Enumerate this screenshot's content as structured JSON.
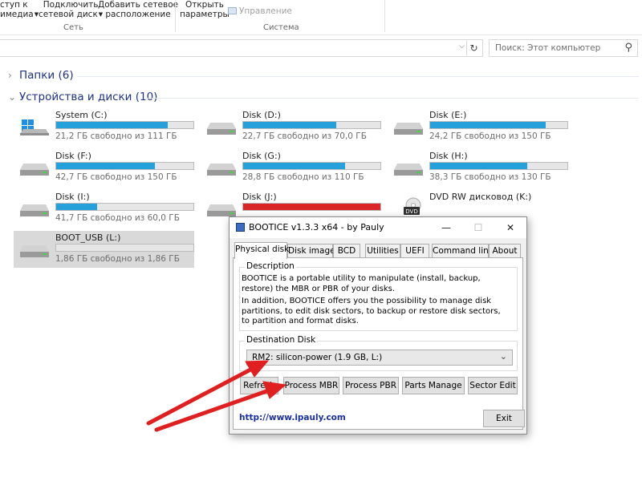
{
  "ribbon": {
    "media_access": {
      "line1": "ступ к",
      "line2": "имедиа"
    },
    "map_drive": {
      "line1": "Подключить",
      "line2": "сетевой диск"
    },
    "add_location": {
      "line1": "Добавить сетевое",
      "line2": "расположение"
    },
    "network_group": "Сеть",
    "open_settings": {
      "line1": "Открыть",
      "line2": "параметры"
    },
    "manage": "Управление",
    "system_group": "Система"
  },
  "address": {
    "refresh_icon": "refresh-icon",
    "search_placeholder": "Поиск: Этот компьютер"
  },
  "sections": {
    "folders": "Папки (6)",
    "devices": "Устройства и диски (10)"
  },
  "drives": [
    {
      "name": "System (C:)",
      "free": "21,2 ГБ свободно из 111 ГБ",
      "used_fraction": 0.81,
      "color": "#26a0da",
      "icon": "windows-drive-icon"
    },
    {
      "name": "Disk (D:)",
      "free": "22,7 ГБ свободно из 70,0 ГБ",
      "used_fraction": 0.68,
      "color": "#26a0da",
      "icon": "hard-drive-icon"
    },
    {
      "name": "Disk (E:)",
      "free": "24,2 ГБ свободно из 150 ГБ",
      "used_fraction": 0.84,
      "color": "#26a0da",
      "icon": "hard-drive-icon"
    },
    {
      "name": "Disk (F:)",
      "free": "42,7 ГБ свободно из 150 ГБ",
      "used_fraction": 0.72,
      "color": "#26a0da",
      "icon": "hard-drive-icon"
    },
    {
      "name": "Disk (G:)",
      "free": "28,8 ГБ свободно из 110 ГБ",
      "used_fraction": 0.74,
      "color": "#26a0da",
      "icon": "hard-drive-icon"
    },
    {
      "name": "Disk (H:)",
      "free": "38,3 ГБ свободно из 130 ГБ",
      "used_fraction": 0.71,
      "color": "#26a0da",
      "icon": "hard-drive-icon"
    },
    {
      "name": "Disk (I:)",
      "free": "41,7 ГБ свободно из 60,0 ГБ",
      "used_fraction": 0.3,
      "color": "#26a0da",
      "icon": "hard-drive-icon"
    },
    {
      "name": "Disk (J:)",
      "free": "",
      "used_fraction": 1.0,
      "color": "#da2626",
      "icon": "hard-drive-icon"
    },
    {
      "name": "DVD RW дисковод (K:)",
      "free": "",
      "used_fraction": null,
      "color": "",
      "icon": "dvd-drive-icon"
    },
    {
      "name": "BOOT_USB (L:)",
      "free": "1,86 ГБ свободно из 1,86 ГБ",
      "used_fraction": 0.0,
      "color": "#26a0da",
      "icon": "usb-drive-icon",
      "selected": true
    }
  ],
  "bootice": {
    "title": "BOOTICE v1.3.3 x64 - by Pauly",
    "minimize": "—",
    "maximize": "☐",
    "close": "✕",
    "tabs": [
      "Physical disk",
      "Disk image",
      "BCD",
      "Utilities",
      "UEFI",
      "Command line",
      "About"
    ],
    "active_tab": 0,
    "description_label": "Description",
    "description_p1": "BOOTICE is a portable utility to manipulate (install, backup, restore) the MBR or PBR of your disks.",
    "description_p2": "In addition, BOOTICE offers you the possibility to manage disk partitions, to edit disk sectors, to backup or restore disk sectors, to partition and format disks.",
    "destination_label": "Destination Disk",
    "destination_value": "RM2:  silicon-power (1.9 GB, L:)",
    "buttons": {
      "refresh": "Refresh",
      "process_mbr": "Process MBR",
      "process_pbr": "Process PBR",
      "parts_manage": "Parts Manage",
      "sector_edit": "Sector Edit",
      "exit": "Exit"
    },
    "link": "http://www.ipauly.com"
  },
  "annotation_color": "#e02020"
}
